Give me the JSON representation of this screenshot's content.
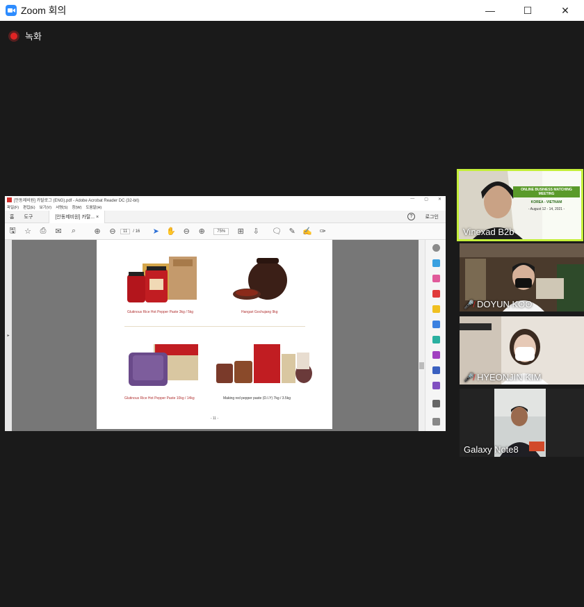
{
  "window": {
    "title": "Zoom 회의",
    "minimize": "—",
    "maximize": "☐",
    "close": "✕"
  },
  "recording": {
    "label": "녹화"
  },
  "shared_screen": {
    "title": "[안동제비원] 카탈로그 (ENG).pdf - Adobe Acrobat Reader DC (32-bit)",
    "menu": [
      "파일(F)",
      "편집(E)",
      "보기(V)",
      "서명(S)",
      "창(W)",
      "도움말(H)"
    ],
    "tabs": {
      "home": "홈",
      "tools": "도구",
      "doc": "[안동제비원] 카탈... ×"
    },
    "help": "?",
    "login": "로그인",
    "page_current": "11",
    "page_total": "/ 16",
    "zoom": "75%",
    "products": [
      {
        "caption": "Glutinous Rice Hot Pepper Paste 3kg / 5kg"
      },
      {
        "caption": "Hangari Gochujang 9kg"
      },
      {
        "caption": "Glutinous Rice Hot Pepper Paste 10kg / 14kg"
      },
      {
        "caption": "Making red pepper paste (D.I.Y) 7kg / 3.5kg"
      }
    ],
    "page_number": "- 11 -"
  },
  "participants": [
    {
      "name": "Vinexad B2b",
      "muted": false,
      "active": true,
      "banner": [
        "ONLINE BUSINESS MATCHING MEETING",
        "KOREA - VIETNAM",
        "- August 12 - 14, 2021 -"
      ]
    },
    {
      "name": "DOYUN KOO",
      "muted": true
    },
    {
      "name": "HYEONJIN KIM",
      "muted": true
    },
    {
      "name": "Galaxy Note8",
      "muted": false
    }
  ],
  "colors": {
    "active_speaker": "#c4ef3a",
    "record": "#e02424",
    "zoom_brand": "#2d8cff"
  }
}
